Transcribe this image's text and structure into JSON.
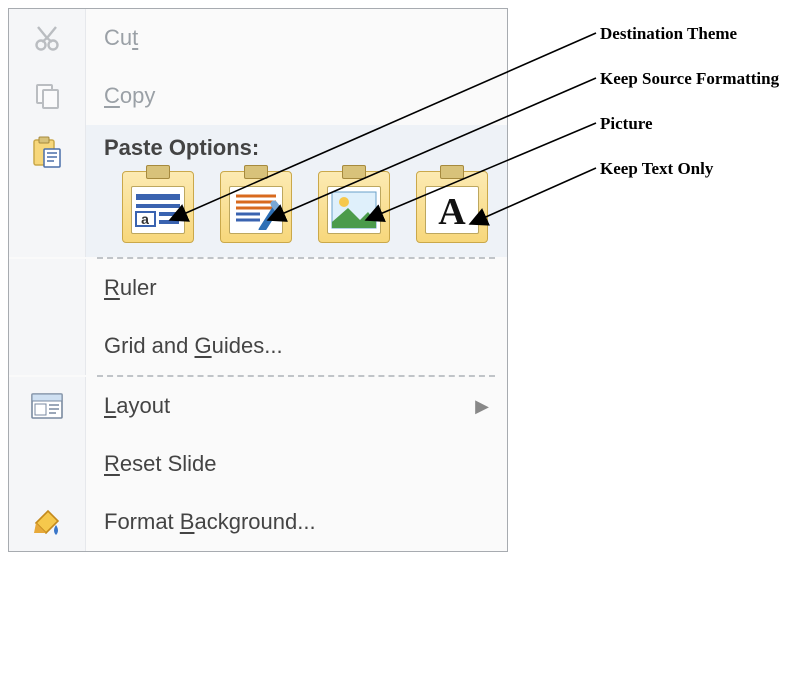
{
  "menu": {
    "cut": {
      "label": "Cut",
      "hotkey_index": 2
    },
    "copy": {
      "label": "Copy",
      "hotkey_index": 0
    },
    "paste_header": "Paste Options:",
    "paste_options": [
      {
        "name": "destination-theme"
      },
      {
        "name": "keep-source-formatting"
      },
      {
        "name": "picture"
      },
      {
        "name": "keep-text-only"
      }
    ],
    "ruler": {
      "label": "Ruler",
      "hotkey_index": 0
    },
    "grid": {
      "label": "Grid and Guides...",
      "hotkey_index": 9
    },
    "layout": {
      "label": "Layout",
      "hotkey_index": 0
    },
    "reset": {
      "label": "Reset Slide",
      "hotkey_index": 0
    },
    "format": {
      "label": "Format Background...",
      "hotkey_index": 7
    }
  },
  "annotations": {
    "dest_theme": "Destination Theme",
    "keep_src": "Keep Source Formatting",
    "picture": "Picture",
    "keep_text": "Keep Text Only"
  }
}
